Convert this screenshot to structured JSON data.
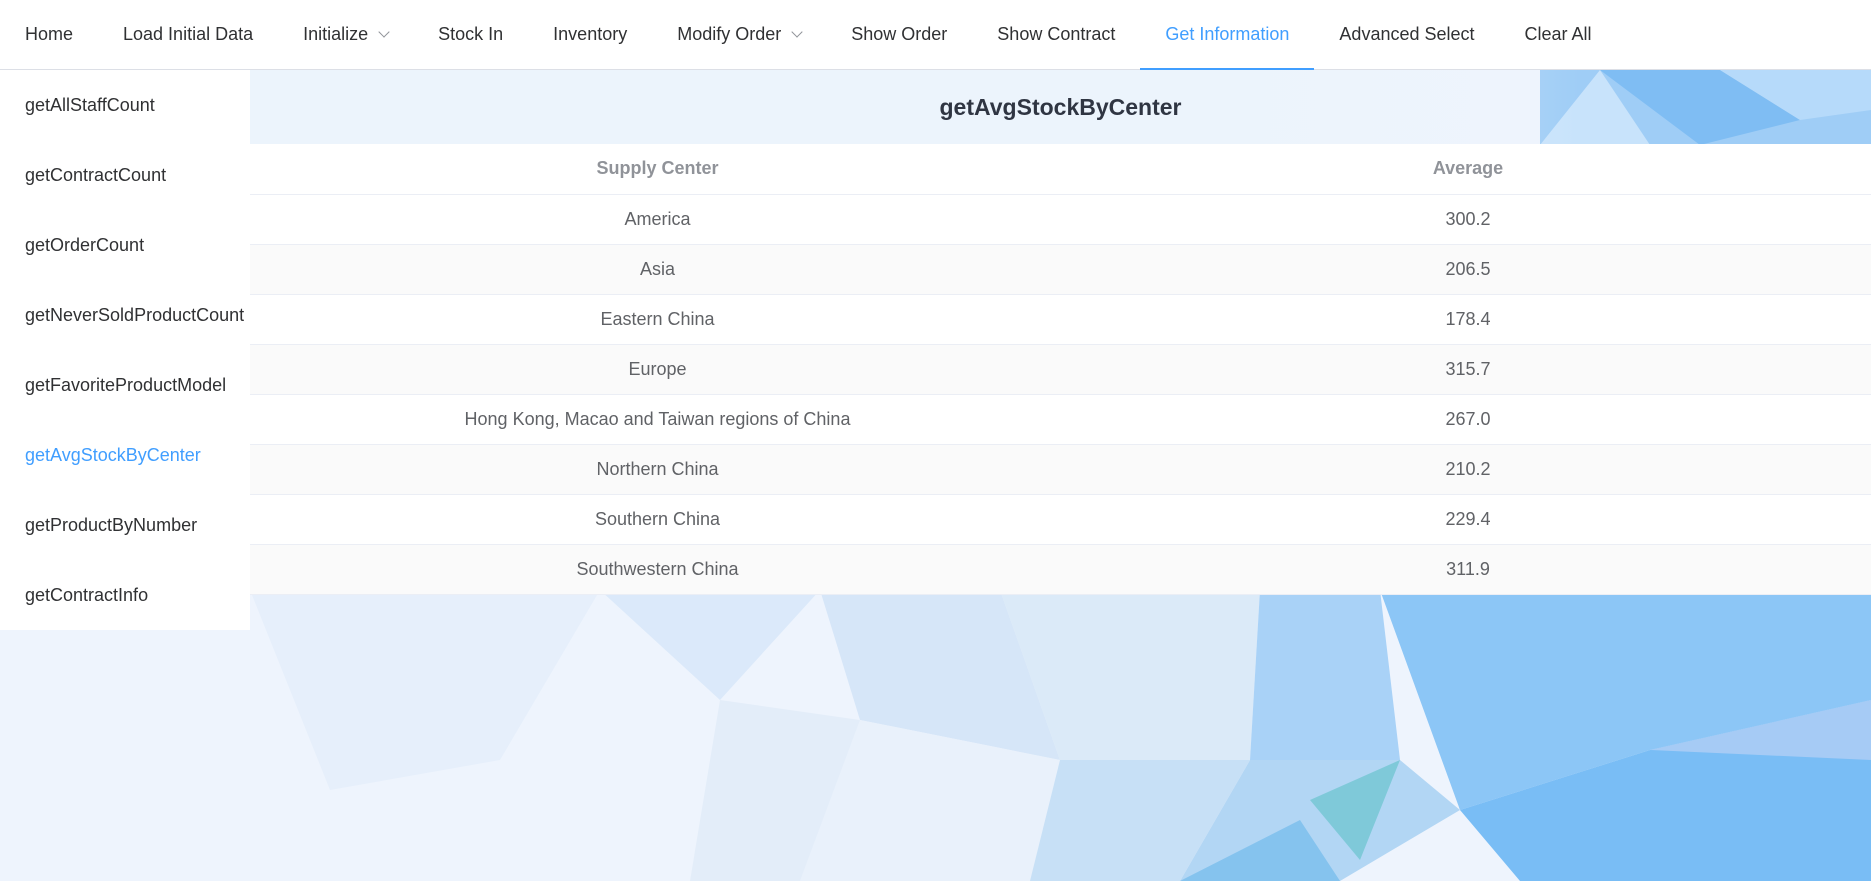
{
  "nav": {
    "items": [
      {
        "label": "Home",
        "dropdown": false,
        "active": false
      },
      {
        "label": "Load Initial Data",
        "dropdown": false,
        "active": false
      },
      {
        "label": "Initialize",
        "dropdown": true,
        "active": false
      },
      {
        "label": "Stock In",
        "dropdown": false,
        "active": false
      },
      {
        "label": "Inventory",
        "dropdown": false,
        "active": false
      },
      {
        "label": "Modify Order",
        "dropdown": true,
        "active": false
      },
      {
        "label": "Show Order",
        "dropdown": false,
        "active": false
      },
      {
        "label": "Show Contract",
        "dropdown": false,
        "active": false
      },
      {
        "label": "Get Information",
        "dropdown": false,
        "active": true
      },
      {
        "label": "Advanced Select",
        "dropdown": false,
        "active": false
      },
      {
        "label": "Clear All",
        "dropdown": false,
        "active": false
      }
    ]
  },
  "sidebar": {
    "items": [
      {
        "label": "getAllStaffCount",
        "active": false
      },
      {
        "label": "getContractCount",
        "active": false
      },
      {
        "label": "getOrderCount",
        "active": false
      },
      {
        "label": "getNeverSoldProductCount",
        "active": false
      },
      {
        "label": "getFavoriteProductModel",
        "active": false
      },
      {
        "label": "getAvgStockByCenter",
        "active": true
      },
      {
        "label": "getProductByNumber",
        "active": false
      },
      {
        "label": "getContractInfo",
        "active": false
      }
    ]
  },
  "panel": {
    "title": "getAvgStockByCenter",
    "columns": [
      "Supply Center",
      "Average"
    ],
    "rows": [
      [
        "America",
        "300.2"
      ],
      [
        "Asia",
        "206.5"
      ],
      [
        "Eastern China",
        "178.4"
      ],
      [
        "Europe",
        "315.7"
      ],
      [
        "Hong Kong, Macao and Taiwan regions of China",
        "267.0"
      ],
      [
        "Northern China",
        "210.2"
      ],
      [
        "Southern China",
        "229.4"
      ],
      [
        "Southwestern China",
        "311.9"
      ]
    ]
  },
  "colors": {
    "accent": "#409eff",
    "text": "#303133",
    "header_text": "#909399"
  }
}
